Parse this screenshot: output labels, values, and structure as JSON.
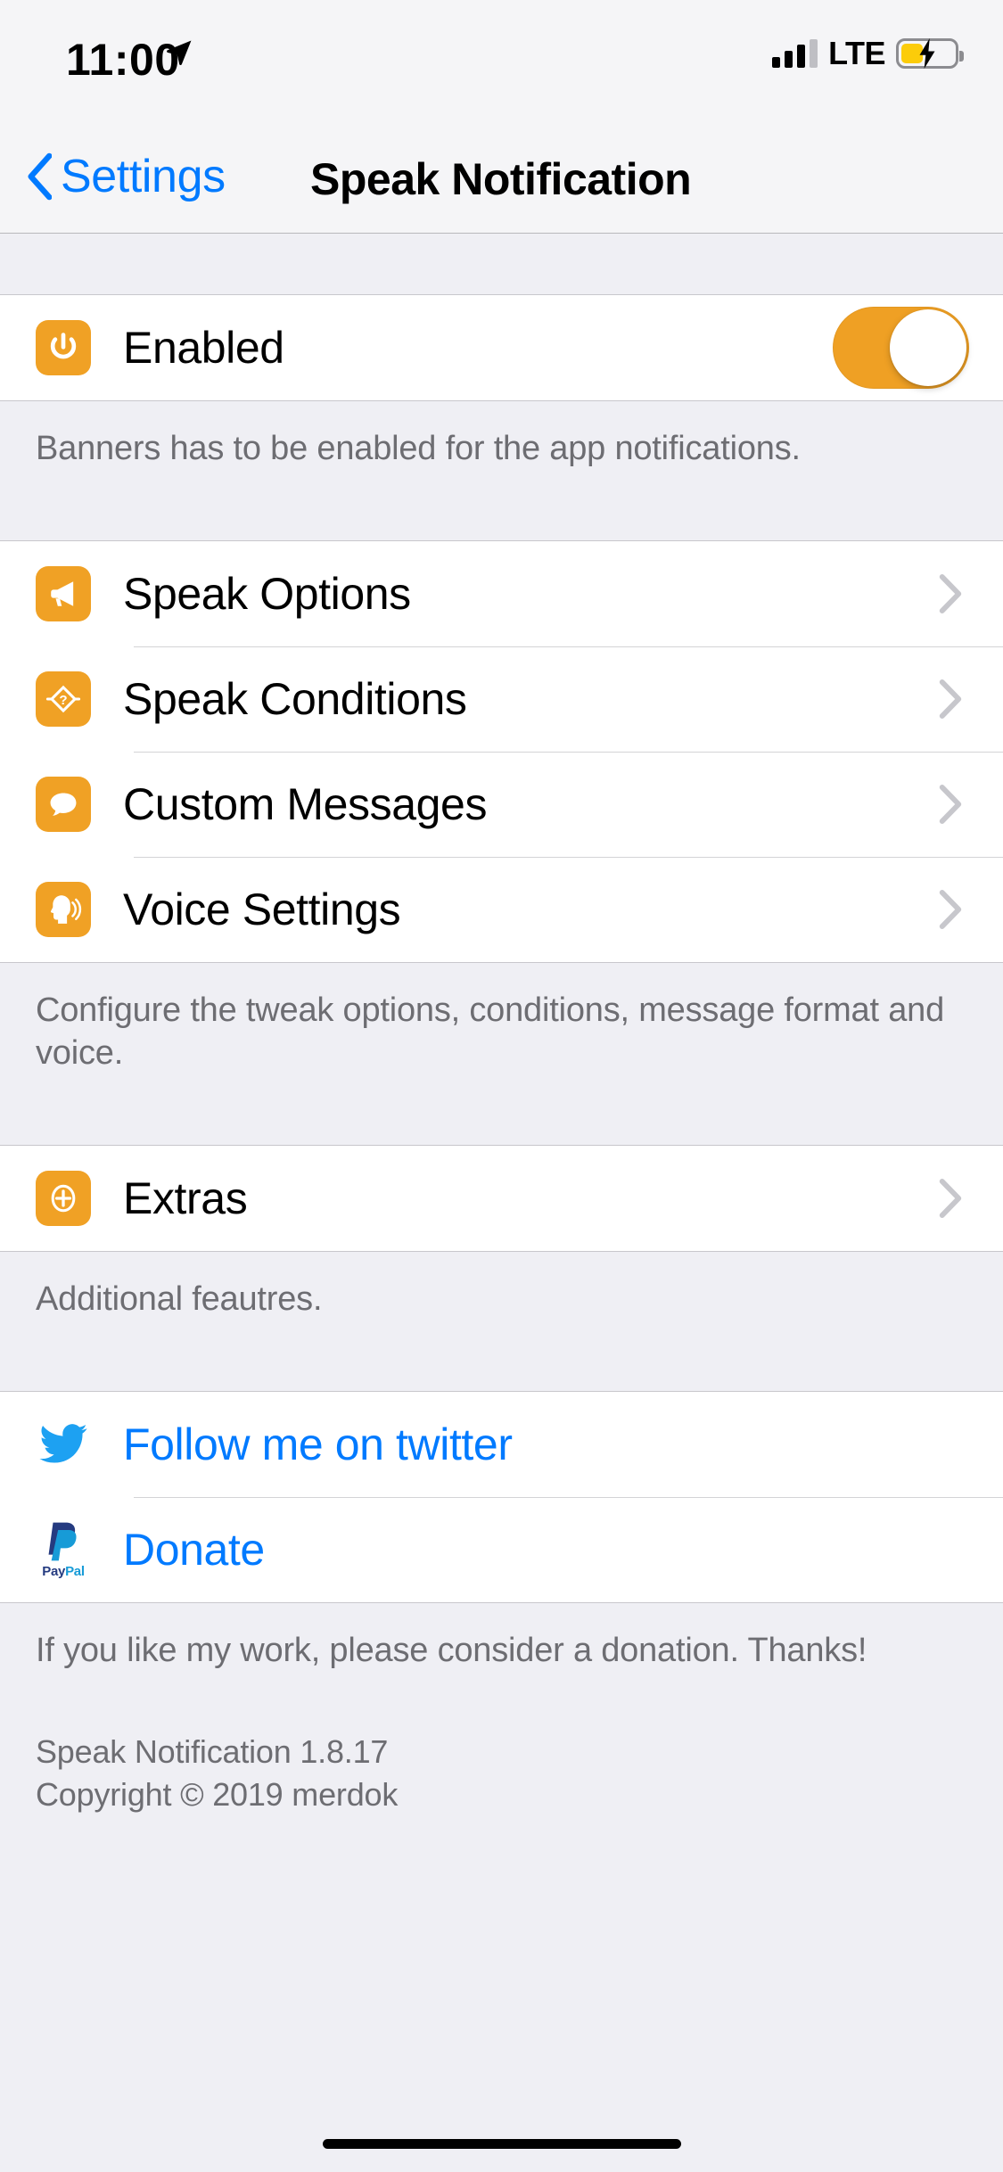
{
  "status_bar": {
    "time": "11:00",
    "location_icon": "location-arrow-icon",
    "carrier_tech": "LTE",
    "signal_bars_filled": 3,
    "signal_bars_total": 4,
    "battery_icon": "battery-charging-icon",
    "battery_color": "#FCCC0A"
  },
  "nav_bar": {
    "back_label": "Settings",
    "back_icon": "chevron-left-icon",
    "title": "Speak Notification"
  },
  "colors": {
    "accent_orange": "#F0A125",
    "toggle_on": "#EFA024",
    "ios_blue": "#007AFF",
    "twitter_blue": "#1DA1F2",
    "paypal_dark": "#253B80",
    "paypal_light": "#179BD7",
    "group_background": "#EFEFF4",
    "row_background": "#FFFFFF",
    "footer_text": "#6D6D72"
  },
  "sections": [
    {
      "rows": [
        {
          "label": "Enabled",
          "icon": "power-icon",
          "control": "toggle",
          "toggle_value": "on"
        }
      ],
      "footer": "Banners has to be enabled for the app notifications."
    },
    {
      "rows": [
        {
          "label": "Speak Options",
          "icon": "megaphone-icon",
          "control": "disclosure"
        },
        {
          "label": "Speak Conditions",
          "icon": "diamond-question-icon",
          "control": "disclosure"
        },
        {
          "label": "Custom Messages",
          "icon": "speech-bubble-icon",
          "control": "disclosure"
        },
        {
          "label": "Voice Settings",
          "icon": "speaking-head-icon",
          "control": "disclosure"
        }
      ],
      "footer": "Configure the tweak options, conditions, message format and voice."
    },
    {
      "rows": [
        {
          "label": "Extras",
          "icon": "plus-circle-icon",
          "control": "disclosure"
        }
      ],
      "footer": "Additional feautres."
    },
    {
      "rows": [
        {
          "label": "Follow me on twitter",
          "icon": "twitter-icon",
          "control": "link"
        },
        {
          "label": "Donate",
          "icon": "paypal-icon",
          "control": "link"
        }
      ],
      "footer": "If you like my work, please consider a donation. Thanks!"
    }
  ],
  "about": {
    "version_line": "Speak Notification 1.8.17",
    "copyright_line": "Copyright © 2019 merdok"
  },
  "paypal_wordmark": {
    "part1": "Pay",
    "part2": "Pal"
  }
}
